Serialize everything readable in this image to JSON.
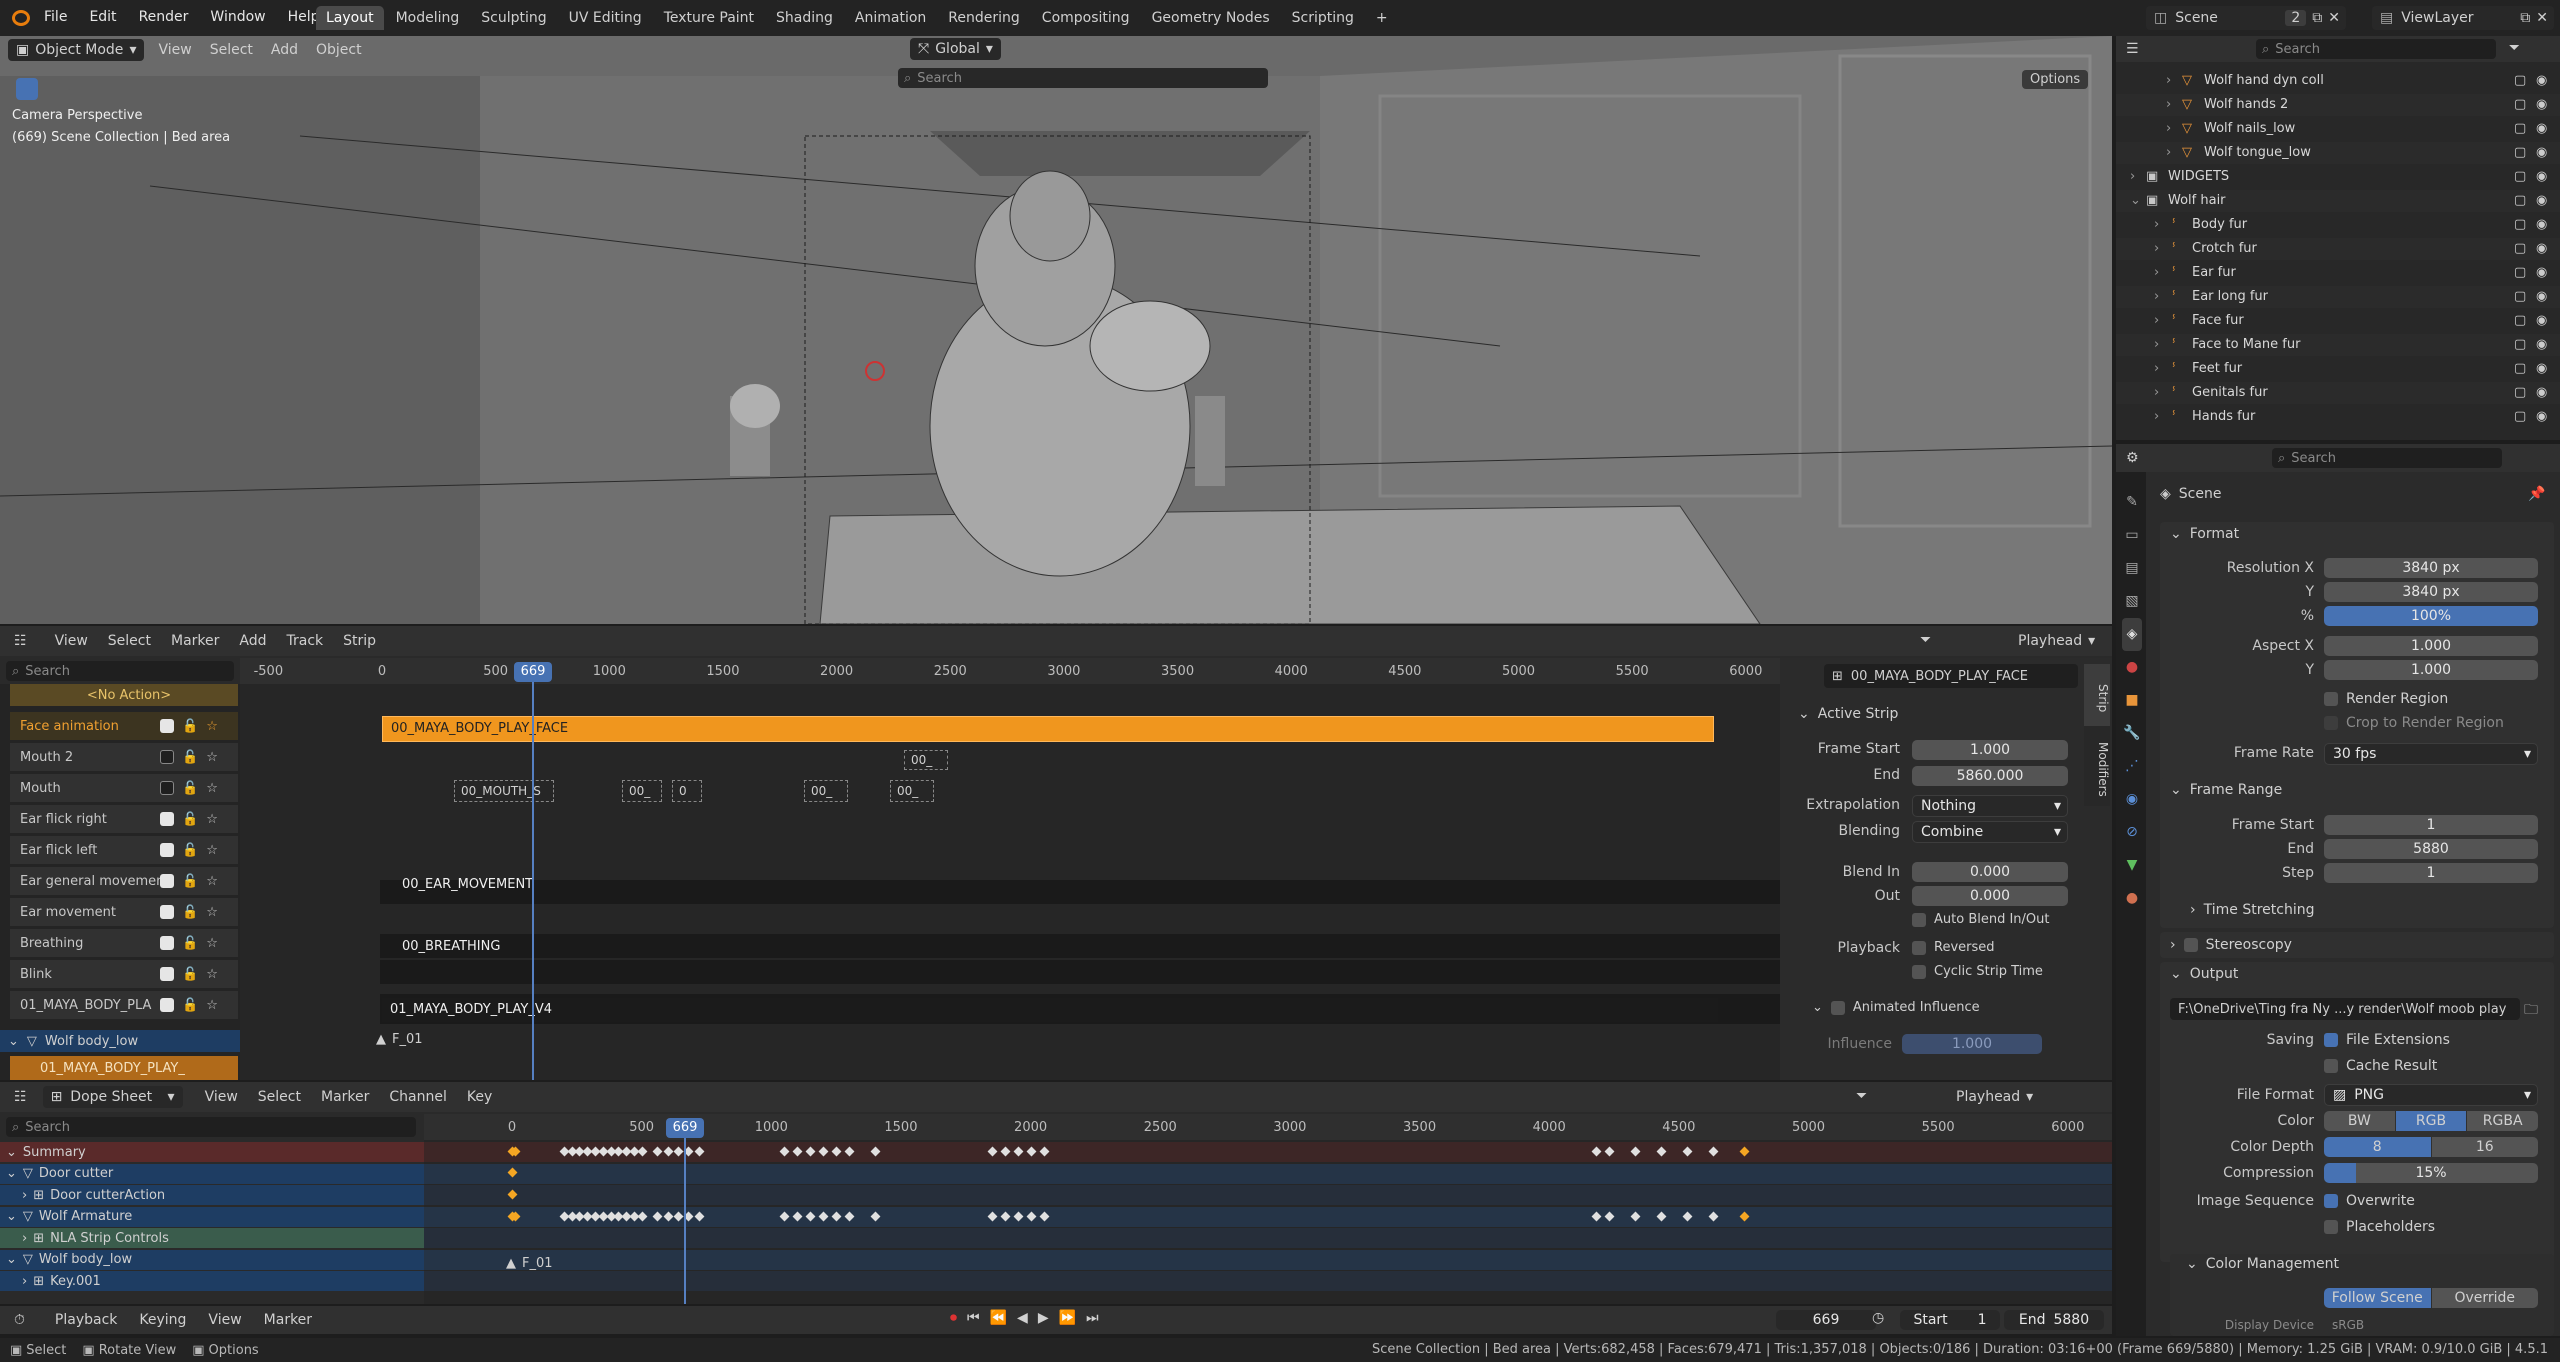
{
  "topbar": {
    "menus": [
      "File",
      "Edit",
      "Render",
      "Window",
      "Help"
    ],
    "workspaces": [
      "Layout",
      "Modeling",
      "Sculpting",
      "UV Editing",
      "Texture Paint",
      "Shading",
      "Animation",
      "Rendering",
      "Compositing",
      "Geometry Nodes",
      "Scripting"
    ],
    "active_workspace": "Layout",
    "scene": "Scene",
    "scene_count": "2",
    "view_layer": "ViewLayer"
  },
  "viewport": {
    "mode": "Object Mode",
    "menus": [
      "View",
      "Select",
      "Add",
      "Object"
    ],
    "orientation": "Global",
    "search_placeholder": "Search",
    "options": "Options",
    "camera_label": "Camera Perspective",
    "collection_label": "(669) Scene Collection | Bed area"
  },
  "outliner": {
    "search_placeholder": "Search",
    "items": [
      {
        "label": "Wolf hand dyn coll",
        "type": "mesh"
      },
      {
        "label": "Wolf hands 2",
        "type": "mesh"
      },
      {
        "label": "Wolf nails_low",
        "type": "mesh"
      },
      {
        "label": "Wolf tongue_low",
        "type": "mesh"
      },
      {
        "label": "WIDGETS",
        "type": "collection"
      },
      {
        "label": "Wolf hair",
        "type": "collection"
      },
      {
        "label": "Body fur",
        "type": "hair"
      },
      {
        "label": "Crotch fur",
        "type": "hair"
      },
      {
        "label": "Ear fur",
        "type": "hair"
      },
      {
        "label": "Ear long fur",
        "type": "hair"
      },
      {
        "label": "Face fur",
        "type": "hair"
      },
      {
        "label": "Face to Mane fur",
        "type": "hair"
      },
      {
        "label": "Feet fur",
        "type": "hair"
      },
      {
        "label": "Genitals fur",
        "type": "hair"
      },
      {
        "label": "Hands fur",
        "type": "hair"
      }
    ]
  },
  "properties": {
    "search_placeholder": "Search",
    "breadcrumb": "Scene",
    "format": {
      "title": "Format",
      "resolution_x_label": "Resolution X",
      "resolution_x": "3840 px",
      "y_label": "Y",
      "resolution_y": "3840 px",
      "pct_label": "%",
      "pct": "100%",
      "aspect_x_label": "Aspect X",
      "aspect_x": "1.000",
      "aspect_y_label": "Y",
      "aspect_y": "1.000",
      "render_region": "Render Region",
      "crop": "Crop to Render Region",
      "frame_rate_label": "Frame Rate",
      "frame_rate": "30 fps"
    },
    "frame_range": {
      "title": "Frame Range",
      "start_label": "Frame Start",
      "start": "1",
      "end_label": "End",
      "end": "5880",
      "step_label": "Step",
      "step": "1",
      "time_stretching": "Time Stretching"
    },
    "stereoscopy": "Stereoscopy",
    "output": {
      "title": "Output",
      "path": "F:\\OneDrive\\Ting fra Ny ...y render\\Wolf moob play",
      "saving_label": "Saving",
      "file_extensions": "File Extensions",
      "cache_result": "Cache Result",
      "file_format_label": "File Format",
      "file_format": "PNG",
      "color_label": "Color",
      "color_options": [
        "BW",
        "RGB",
        "RGBA"
      ],
      "color_active": "RGB",
      "depth_label": "Color Depth",
      "depth_options": [
        "8",
        "16"
      ],
      "depth_active": "8",
      "compression_label": "Compression",
      "compression": "15%",
      "image_sequence_label": "Image Sequence",
      "overwrite": "Overwrite",
      "placeholders": "Placeholders"
    },
    "color_management": {
      "title": "Color Management",
      "follow_scene": "Follow Scene",
      "override": "Override",
      "display_device_label": "Display Device",
      "display_device": "sRGB"
    }
  },
  "nla": {
    "menus": [
      "View",
      "Select",
      "Marker",
      "Add",
      "Track",
      "Strip"
    ],
    "playhead_label": "Playhead",
    "search_placeholder": "Search",
    "frame_ticks": [
      "-500",
      "0",
      "500",
      "1000",
      "1500",
      "2000",
      "2500",
      "3000",
      "3500",
      "4000",
      "4500",
      "5000",
      "5500",
      "6000"
    ],
    "current_frame": "669",
    "no_action": "<No Action>",
    "tracks": [
      {
        "label": "Face animation",
        "checked": true
      },
      {
        "label": "Mouth 2",
        "checked": false
      },
      {
        "label": "Mouth",
        "checked": false
      },
      {
        "label": "Ear flick right",
        "checked": true
      },
      {
        "label": "Ear flick left",
        "checked": true
      },
      {
        "label": "Ear general movemen",
        "checked": true
      },
      {
        "label": "Ear movement",
        "checked": true
      },
      {
        "label": "Breathing",
        "checked": true
      },
      {
        "label": "Blink",
        "checked": true
      },
      {
        "label": "01_MAYA_BODY_PLA",
        "checked": true
      }
    ],
    "object_label": "Wolf body_low",
    "action_label": "01_MAYA_BODY_PLAY_",
    "strips": {
      "face": "00_MAYA_BODY_PLAY_FACE",
      "mouth2": "00_",
      "mouth": [
        "00_MOUTH_S",
        "00_",
        "0",
        "00_",
        "00_"
      ],
      "ear_general": "00_EAR_MOVEMENT",
      "breathing": "00_BREATHING",
      "body": "01_MAYA_BODY_PLAY_V4"
    },
    "marker": "F_01",
    "sidebar": {
      "strip_name": "00_MAYA_BODY_PLAY_FACE",
      "tabs": [
        "Strip",
        "Modifiers"
      ],
      "active_strip": "Active Strip",
      "frame_start_label": "Frame Start",
      "frame_start": "1.000",
      "end_label": "End",
      "end": "5860.000",
      "extrapolation_label": "Extrapolation",
      "extrapolation": "Nothing",
      "blending_label": "Blending",
      "blending": "Combine",
      "blend_in_label": "Blend In",
      "blend_in": "0.000",
      "out_label": "Out",
      "out": "0.000",
      "auto_blend": "Auto Blend In/Out",
      "playback_label": "Playback",
      "reversed": "Reversed",
      "cyclic": "Cyclic Strip Time",
      "animated_influence": "Animated Influence",
      "influence_label": "Influence",
      "influence": "1.000"
    }
  },
  "dopesheet": {
    "mode": "Dope Sheet",
    "menus": [
      "View",
      "Select",
      "Marker",
      "Channel",
      "Key"
    ],
    "playhead_label": "Playhead",
    "search_placeholder": "Search",
    "frame_ticks": [
      "0",
      "500",
      "1000",
      "1500",
      "2000",
      "2500",
      "3000",
      "3500",
      "4000",
      "4500",
      "5000",
      "5500",
      "6000"
    ],
    "current_frame": "669",
    "channels": [
      {
        "label": "Summary",
        "kind": "summary"
      },
      {
        "label": "Door cutter",
        "kind": "object"
      },
      {
        "label": "Door cutterAction",
        "kind": "action"
      },
      {
        "label": "Wolf Armature",
        "kind": "object"
      },
      {
        "label": "NLA Strip Controls",
        "kind": "nla"
      },
      {
        "label": "Wolf body_low",
        "kind": "object"
      },
      {
        "label": "Key.001",
        "kind": "action"
      }
    ],
    "marker": "F_01"
  },
  "timeline": {
    "menus": [
      "Playback",
      "Keying",
      "View",
      "Marker"
    ],
    "current_frame": "669",
    "start_label": "Start",
    "start": "1",
    "end_label": "End",
    "end": "5880"
  },
  "statusbar": {
    "hints": [
      "Select",
      "Rotate View",
      "Options"
    ],
    "info": "Scene Collection | Bed area | Verts:682,458 | Faces:679,471 | Tris:1,357,018 | Objects:0/186 | Duration: 03:16+00 (Frame 669/5880) | Memory: 1.25 GiB | VRAM: 0.9/10.0 GiB | 4.5.1"
  },
  "colors": {
    "accent": "#4772b3",
    "strip_active": "#f0961e",
    "playhead": "#5680c2"
  }
}
